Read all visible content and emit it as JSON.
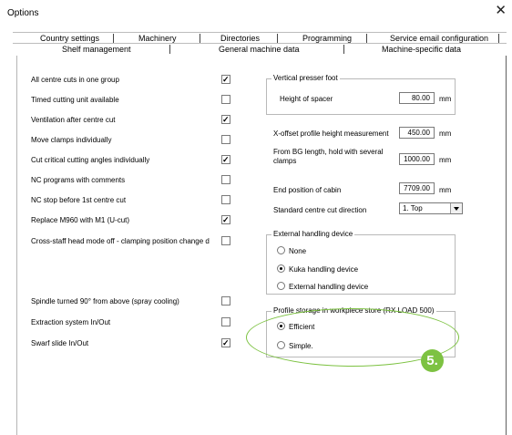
{
  "window": {
    "title": "Options",
    "close_glyph": "✕"
  },
  "tabs": {
    "row1": [
      "Country settings",
      "Machinery",
      "Directories",
      "Programming",
      "Service email configuration"
    ],
    "row2": [
      "Shelf management",
      "General machine data",
      "Machine-specific data"
    ]
  },
  "checkboxes": [
    {
      "label": "All centre cuts in one group",
      "checked": true
    },
    {
      "label": "Timed cutting unit available",
      "checked": false
    },
    {
      "label": "Ventilation after centre cut",
      "checked": true
    },
    {
      "label": "Move clamps individually",
      "checked": false
    },
    {
      "label": "Cut critical cutting angles individually",
      "checked": true
    },
    {
      "label": "NC programs with comments",
      "checked": false
    },
    {
      "label": "NC stop before 1st centre cut",
      "checked": false
    },
    {
      "label": "Replace M960 with M1 (U-cut)",
      "checked": true
    },
    {
      "label": "Cross-staff head mode off - clamping position change d",
      "checked": false
    },
    {
      "label": "Spindle turned 90° from above (spray cooling)",
      "checked": false
    },
    {
      "label": "Extraction system In/Out",
      "checked": false
    },
    {
      "label": "Swarf slide In/Out",
      "checked": true
    }
  ],
  "vertical_presser": {
    "title": "Vertical presser foot",
    "label": "Height of spacer",
    "value": "80.00",
    "unit": "mm"
  },
  "x_offset": {
    "label": "X-offset profile height measurement",
    "value": "450.00",
    "unit": "mm"
  },
  "bg_length": {
    "label_line1": "From BG length, hold with several",
    "label_line2": "clamps",
    "value": "1000.00",
    "unit": "mm"
  },
  "cabin": {
    "label": "End position of cabin",
    "value": "7709.00",
    "unit": "mm"
  },
  "cut_direction": {
    "label": "Standard centre cut direction",
    "value": "1. Top"
  },
  "external_handling": {
    "title": "External handling device",
    "options": [
      "None",
      "Kuka handling device",
      "External handling device"
    ],
    "selected": 1
  },
  "profile_storage": {
    "title": "Profile storage in workpiece store (RX LOAD 500)",
    "options": [
      "Efficient",
      "Simple."
    ],
    "selected": 0
  },
  "callout": {
    "number": "5.",
    "color": "#7dc242"
  }
}
